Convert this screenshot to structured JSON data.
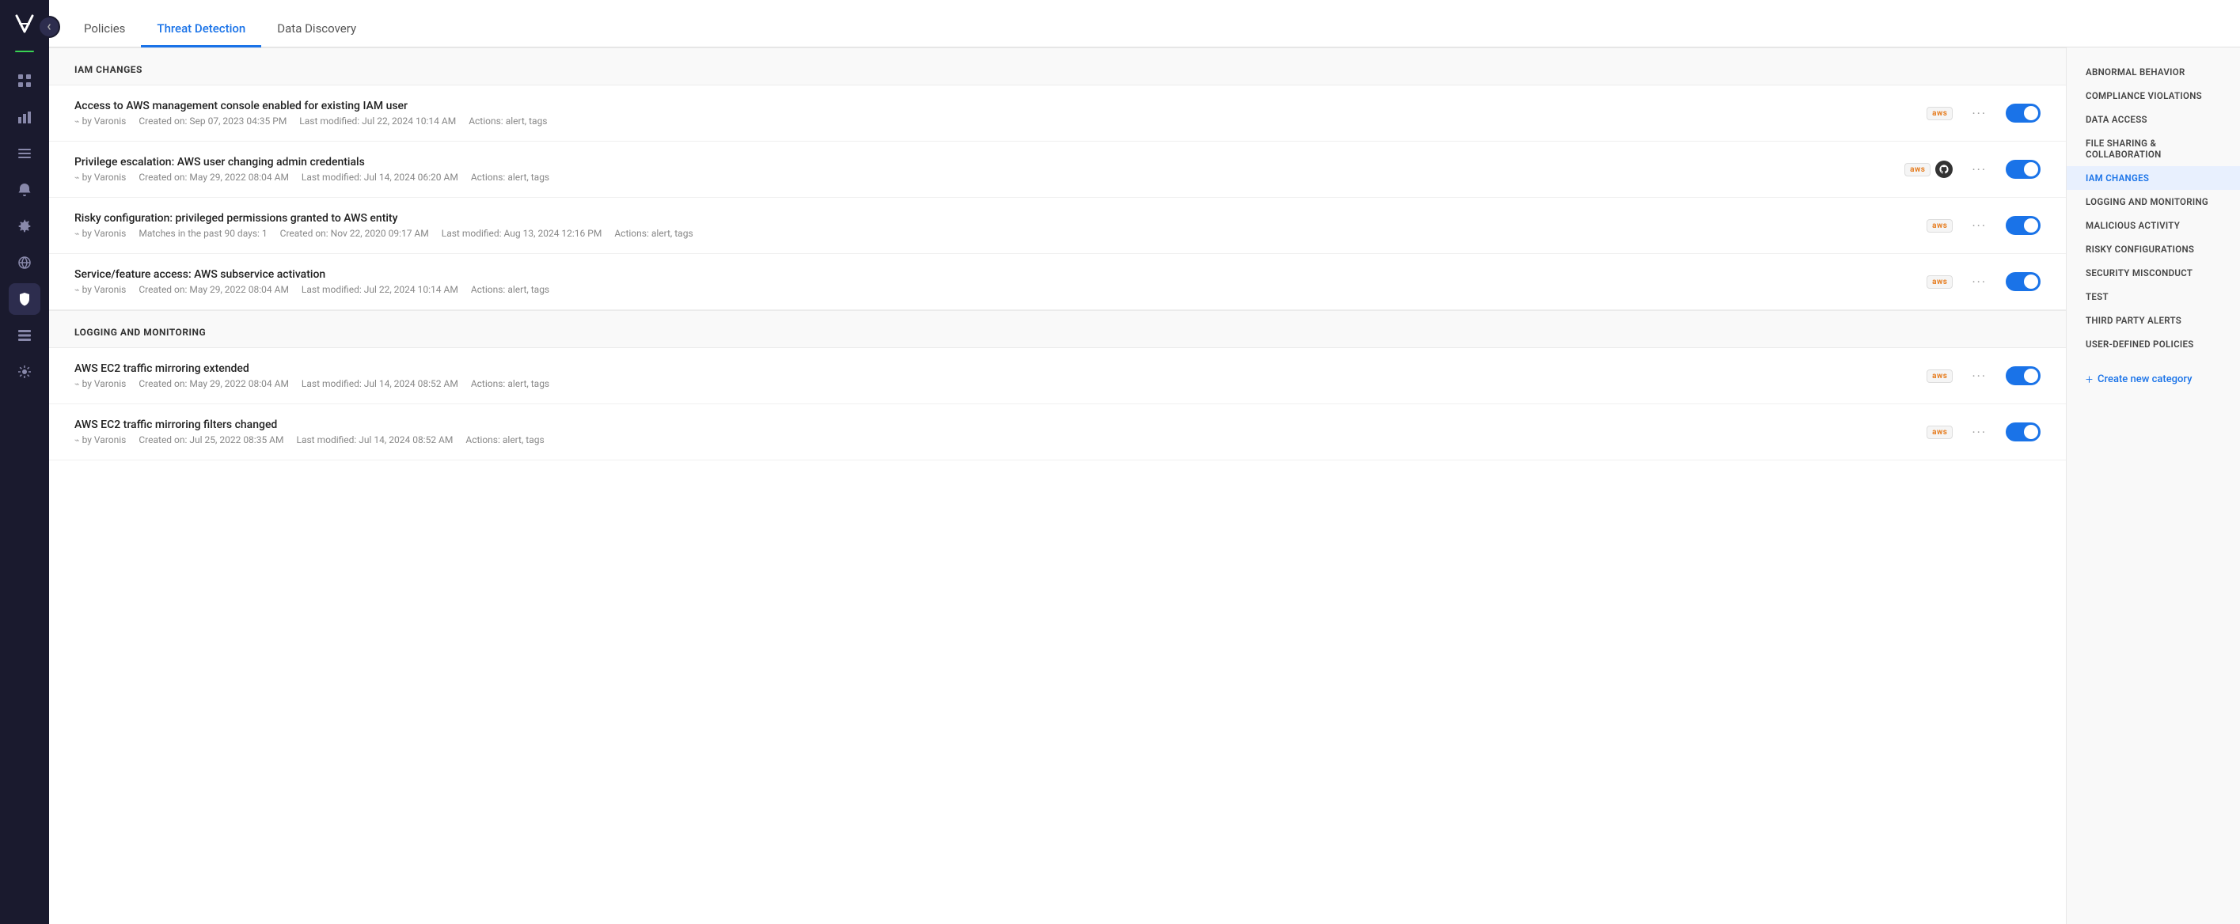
{
  "app": {
    "title": "Varonis"
  },
  "tabs": [
    {
      "id": "policies",
      "label": "Policies",
      "active": false
    },
    {
      "id": "threat-detection",
      "label": "Threat Detection",
      "active": true
    },
    {
      "id": "data-discovery",
      "label": "Data Discovery",
      "active": false
    }
  ],
  "categories": [
    {
      "id": "iam-changes",
      "label": "IAM CHANGES",
      "policies": [
        {
          "id": "pol-1",
          "name": "Access to AWS management console enabled for existing IAM user",
          "author": "Varonis",
          "created": "Created on: Sep 07, 2023 04:35 PM",
          "modified": "Last modified: Jul 22, 2024 10:14 AM",
          "actions": "Actions: alert, tags",
          "badges": [
            "aws"
          ],
          "enabled": true
        },
        {
          "id": "pol-2",
          "name": "Privilege escalation: AWS user changing admin credentials",
          "author": "Varonis",
          "created": "Created on: May 29, 2022 08:04 AM",
          "modified": "Last modified: Jul 14, 2024 06:20 AM",
          "actions": "Actions: alert, tags",
          "badges": [
            "aws",
            "github"
          ],
          "enabled": true
        },
        {
          "id": "pol-3",
          "name": "Risky configuration: privileged permissions granted to AWS entity",
          "author": "Varonis",
          "matches": "Matches in the past 90 days: 1",
          "created": "Created on: Nov 22, 2020 09:17 AM",
          "modified": "Last modified: Aug 13, 2024 12:16 PM",
          "actions": "Actions: alert, tags",
          "badges": [
            "aws"
          ],
          "enabled": true
        },
        {
          "id": "pol-4",
          "name": "Service/feature access: AWS subservice activation",
          "author": "Varonis",
          "created": "Created on: May 29, 2022 08:04 AM",
          "modified": "Last modified: Jul 22, 2024 10:14 AM",
          "actions": "Actions: alert, tags",
          "badges": [
            "aws"
          ],
          "enabled": true
        }
      ]
    },
    {
      "id": "logging-and-monitoring",
      "label": "LOGGING AND MONITORING",
      "policies": [
        {
          "id": "pol-5",
          "name": "AWS EC2 traffic mirroring extended",
          "author": "Varonis",
          "created": "Created on: May 29, 2022 08:04 AM",
          "modified": "Last modified: Jul 14, 2024 08:52 AM",
          "actions": "Actions: alert, tags",
          "badges": [
            "aws"
          ],
          "enabled": true
        },
        {
          "id": "pol-6",
          "name": "AWS EC2 traffic mirroring filters changed",
          "author": "Varonis",
          "created": "Created on: Jul 25, 2022 08:35 AM",
          "modified": "Last modified: Jul 14, 2024 08:52 AM",
          "actions": "Actions: alert, tags",
          "badges": [
            "aws"
          ],
          "enabled": true
        }
      ]
    }
  ],
  "right_sidebar": {
    "items": [
      {
        "id": "abnormal-behavior",
        "label": "ABNORMAL BEHAVIOR",
        "active": false
      },
      {
        "id": "compliance-violations",
        "label": "COMPLIANCE VIOLATIONS",
        "active": false
      },
      {
        "id": "data-access",
        "label": "DATA ACCESS",
        "active": false
      },
      {
        "id": "file-sharing-collaboration",
        "label": "FILE SHARING & COLLABORATION",
        "active": false
      },
      {
        "id": "iam-changes",
        "label": "IAM CHANGES",
        "active": true
      },
      {
        "id": "logging-monitoring",
        "label": "LOGGING AND MONITORING",
        "active": false
      },
      {
        "id": "malicious-activity",
        "label": "MALICIOUS ACTIVITY",
        "active": false
      },
      {
        "id": "risky-configurations",
        "label": "RISKY CONFIGURATIONS",
        "active": false
      },
      {
        "id": "security-misconduct",
        "label": "SECURITY MISCONDUCT",
        "active": false
      },
      {
        "id": "test",
        "label": "TEST",
        "active": false
      },
      {
        "id": "third-party-alerts",
        "label": "THIRD PARTY ALERTS",
        "active": false
      },
      {
        "id": "user-defined-policies",
        "label": "USER-DEFINED POLICIES",
        "active": false
      }
    ],
    "create_category_label": "Create new category"
  },
  "sidebar_nav": [
    {
      "id": "dashboard",
      "icon": "chart-icon"
    },
    {
      "id": "alerts",
      "icon": "bar-chart-icon"
    },
    {
      "id": "policies",
      "icon": "list-icon"
    },
    {
      "id": "notifications",
      "icon": "bell-icon"
    },
    {
      "id": "settings",
      "icon": "settings-icon"
    },
    {
      "id": "network",
      "icon": "network-icon"
    },
    {
      "id": "security",
      "icon": "shield-icon"
    },
    {
      "id": "data",
      "icon": "data-icon"
    },
    {
      "id": "integrations",
      "icon": "gear-icon"
    }
  ]
}
